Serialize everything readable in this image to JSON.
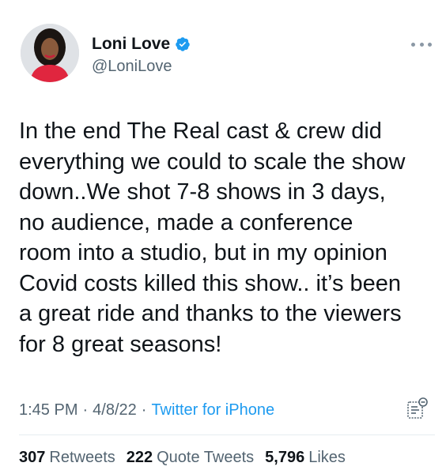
{
  "author": {
    "display_name": "Loni Love",
    "handle": "@LoniLove",
    "verified_icon": "verified-badge-icon",
    "avatar_icon": "avatar-photo"
  },
  "tweet": {
    "lines": [
      "In the end The Real cast & crew did",
      "everything we could to scale the show",
      "down..We shot 7-8 shows in 3 days,",
      "no audience, made a conference",
      "room into a studio,  but in my opinion",
      "Covid costs killed this show.. it’s been",
      "a great ride and thanks to the viewers",
      "for 8 great seasons!"
    ],
    "time": "1:45 PM",
    "date": "4/8/22",
    "separator": "·",
    "source": "Twitter for iPhone"
  },
  "stats": {
    "retweets_count": "307",
    "retweets_label": "Retweets",
    "quotes_count": "222",
    "quotes_label": "Quote Tweets",
    "likes_count": "5,796",
    "likes_label": "Likes"
  },
  "colors": {
    "link": "#1d9bf0",
    "muted": "#536471",
    "text": "#0f1419",
    "verified": "#1d9bf0"
  }
}
